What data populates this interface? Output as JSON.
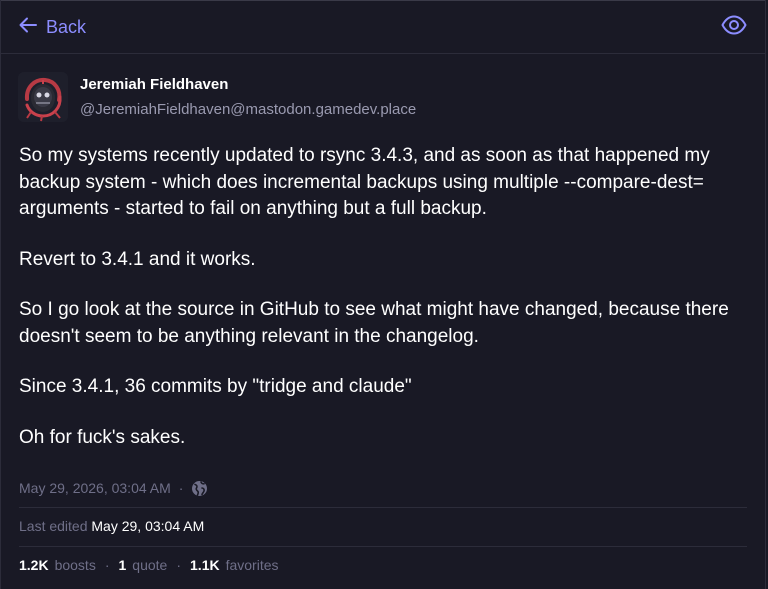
{
  "nav": {
    "back_label": "Back",
    "back_icon": "arrow-left-icon",
    "visibility_icon": "eye-icon"
  },
  "author": {
    "display_name": "Jeremiah Fieldhaven",
    "handle": "@JeremiahFieldhaven@mastodon.gamedev.place"
  },
  "post": {
    "paragraphs": [
      "So my systems recently updated to rsync 3.4.3, and as soon as that happened my backup system - which does incremental backups using multiple --compare-dest= arguments - started to fail on anything but a full backup.",
      "Revert to 3.4.1 and it works.",
      "So I go look at the source in GitHub to see what might have changed, because there doesn't seem to be anything relevant in the changelog.",
      "Since 3.4.1,  36 commits by \"tridge and claude\"",
      "Oh for fuck's sakes."
    ],
    "timestamp": "May 29, 2026, 03:04 AM",
    "separator": "·",
    "visibility": "globe-icon",
    "last_edited_label": "Last edited",
    "last_edited_value": "May 29, 03:04 AM"
  },
  "stats": {
    "boosts_count": "1.2K",
    "boosts_label": "boosts",
    "quotes_count": "1",
    "quotes_label": "quote",
    "favorites_count": "1.1K",
    "favorites_label": "favorites",
    "separator": "·"
  },
  "colors": {
    "background": "#191925",
    "accent": "#8c8dff",
    "muted": "#6f6f88",
    "divider": "#2c2c3a"
  }
}
